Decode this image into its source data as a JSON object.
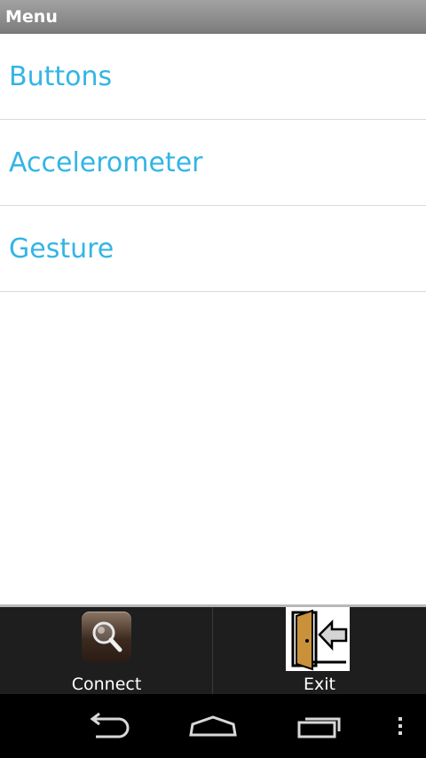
{
  "title_bar": {
    "title": "Menu"
  },
  "menu": {
    "items": [
      {
        "label": "Buttons"
      },
      {
        "label": "Accelerometer"
      },
      {
        "label": "Gesture"
      }
    ],
    "accent_color": "#33b5e5"
  },
  "bottom_menu": {
    "connect": {
      "label": "Connect",
      "icon": "magnifier-icon"
    },
    "exit": {
      "label": "Exit",
      "icon": "exit-door-icon"
    }
  },
  "nav_bar": {
    "buttons": [
      "back-icon",
      "home-icon",
      "recent-apps-icon",
      "overflow-menu-icon"
    ]
  }
}
